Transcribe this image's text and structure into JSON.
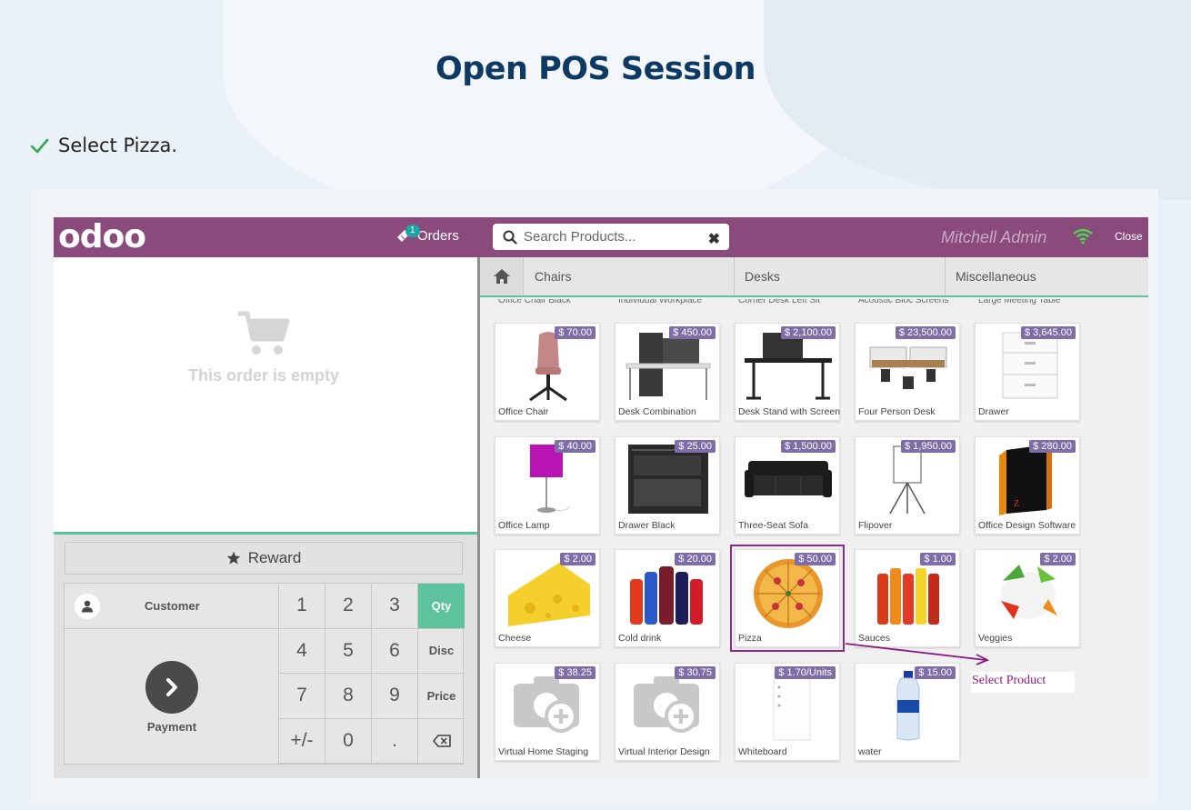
{
  "slide": {
    "title": "Open POS Session",
    "step": "Select Pizza."
  },
  "header": {
    "logo": "odoo",
    "orders_label": "Orders",
    "orders_count": "1",
    "search_placeholder": "Search Products...",
    "user": "Mitchell Admin",
    "close_label": "Close",
    "brand_color": "#8a4b7c"
  },
  "order": {
    "empty_text": "This order is empty"
  },
  "controls": {
    "reward_label": "Reward",
    "customer_label": "Customer",
    "payment_label": "Payment",
    "keys": [
      "1",
      "2",
      "3",
      "Qty",
      "4",
      "5",
      "6",
      "Disc",
      "7",
      "8",
      "9",
      "Price",
      "+/-",
      "0",
      ".",
      "⌫"
    ],
    "active_mode": "Qty",
    "accent_color": "#5dc39c"
  },
  "categories": [
    "Chairs",
    "Desks",
    "Miscellaneous"
  ],
  "cut_row": [
    "Office Chair Black",
    "Individual Workplace",
    "Corner Desk Left Sit",
    "Acoustic Bloc Screens",
    "Large Meeting Table"
  ],
  "products": [
    {
      "name": "Office Chair",
      "price": "$ 70.00",
      "icon": "chair"
    },
    {
      "name": "Desk Combination",
      "price": "$ 450.00",
      "icon": "desk-combo"
    },
    {
      "name": "Desk Stand with Screen",
      "price": "$ 2,100.00",
      "icon": "desk-stand"
    },
    {
      "name": "Four Person Desk",
      "price": "$ 23,500.00",
      "icon": "four-desk"
    },
    {
      "name": "Drawer",
      "price": "$ 3,645.00",
      "icon": "drawer"
    },
    {
      "name": "Office Lamp",
      "price": "$ 40.00",
      "icon": "lamp"
    },
    {
      "name": "Drawer Black",
      "price": "$ 25.00",
      "icon": "drawer-black"
    },
    {
      "name": "Three-Seat Sofa",
      "price": "$ 1,500.00",
      "icon": "sofa"
    },
    {
      "name": "Flipover",
      "price": "$ 1,950.00",
      "icon": "flipover"
    },
    {
      "name": "Office Design Software",
      "price": "$ 280.00",
      "icon": "software-box"
    },
    {
      "name": "Cheese",
      "price": "$ 2.00",
      "icon": "cheese"
    },
    {
      "name": "Cold drink",
      "price": "$ 20.00",
      "icon": "bottles"
    },
    {
      "name": "Pizza",
      "price": "$ 50.00",
      "icon": "pizza",
      "selected": true
    },
    {
      "name": "Sauces",
      "price": "$ 1.00",
      "icon": "sauces"
    },
    {
      "name": "Veggies",
      "price": "$ 2.00",
      "icon": "veggies"
    },
    {
      "name": "Virtual Home Staging",
      "price": "$ 38.25",
      "icon": "camera-plus"
    },
    {
      "name": "Virtual Interior Design",
      "price": "$ 30.75",
      "icon": "camera-plus"
    },
    {
      "name": "Whiteboard",
      "price": "$ 1.70/Units",
      "icon": "whiteboard"
    },
    {
      "name": "water",
      "price": "$ 15.00",
      "icon": "water-bottle"
    }
  ],
  "annotation": {
    "label": "Select  Product",
    "color": "#8a1a86"
  }
}
